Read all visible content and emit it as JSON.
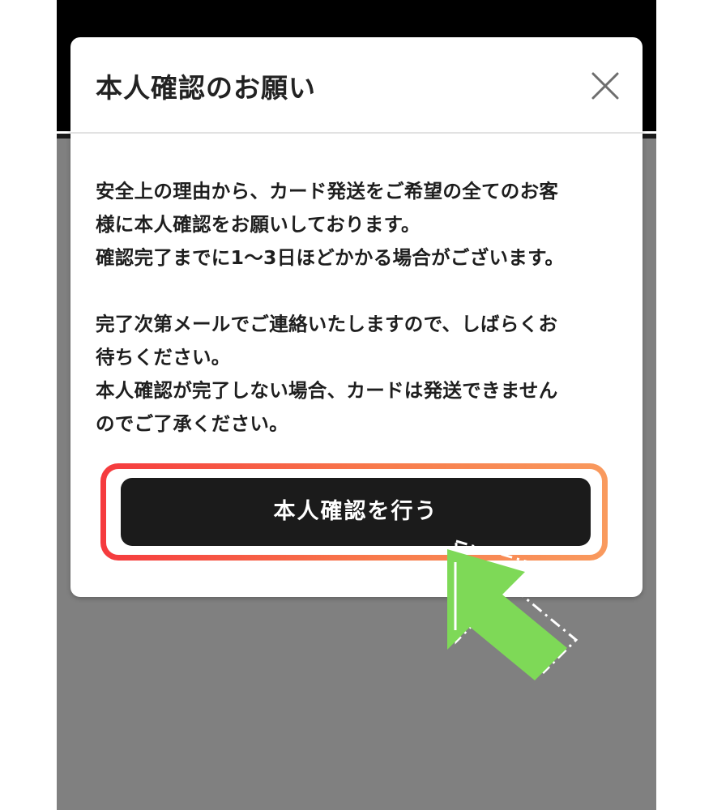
{
  "modal": {
    "title": "本人確認のお願い",
    "close_icon": "close-icon",
    "paragraphs": [
      {
        "lines": [
          "安全上の理由から、カード発送をご希望の全てのお客",
          "様に本人確認をお願いしております。",
          "確認完了までに1〜3日ほどかかる場合がございます。"
        ]
      },
      {
        "lines": [
          "完了次第メールでご連絡いたしますので、しばらくお",
          "待ちください。",
          "本人確認が完了しない場合、カードは発送できません",
          "のでご了承ください。"
        ]
      }
    ],
    "cta_label": "本人確認を行う"
  },
  "annotation": {
    "arrow_icon": "pointer-arrow-icon",
    "arrow_color": "#7ed957",
    "highlight_colors": [
      "#f53a3e",
      "#f99a5e"
    ]
  },
  "colors": {
    "backdrop": "#808080",
    "top_bar": "#000000",
    "button": "#1b1b1b"
  }
}
